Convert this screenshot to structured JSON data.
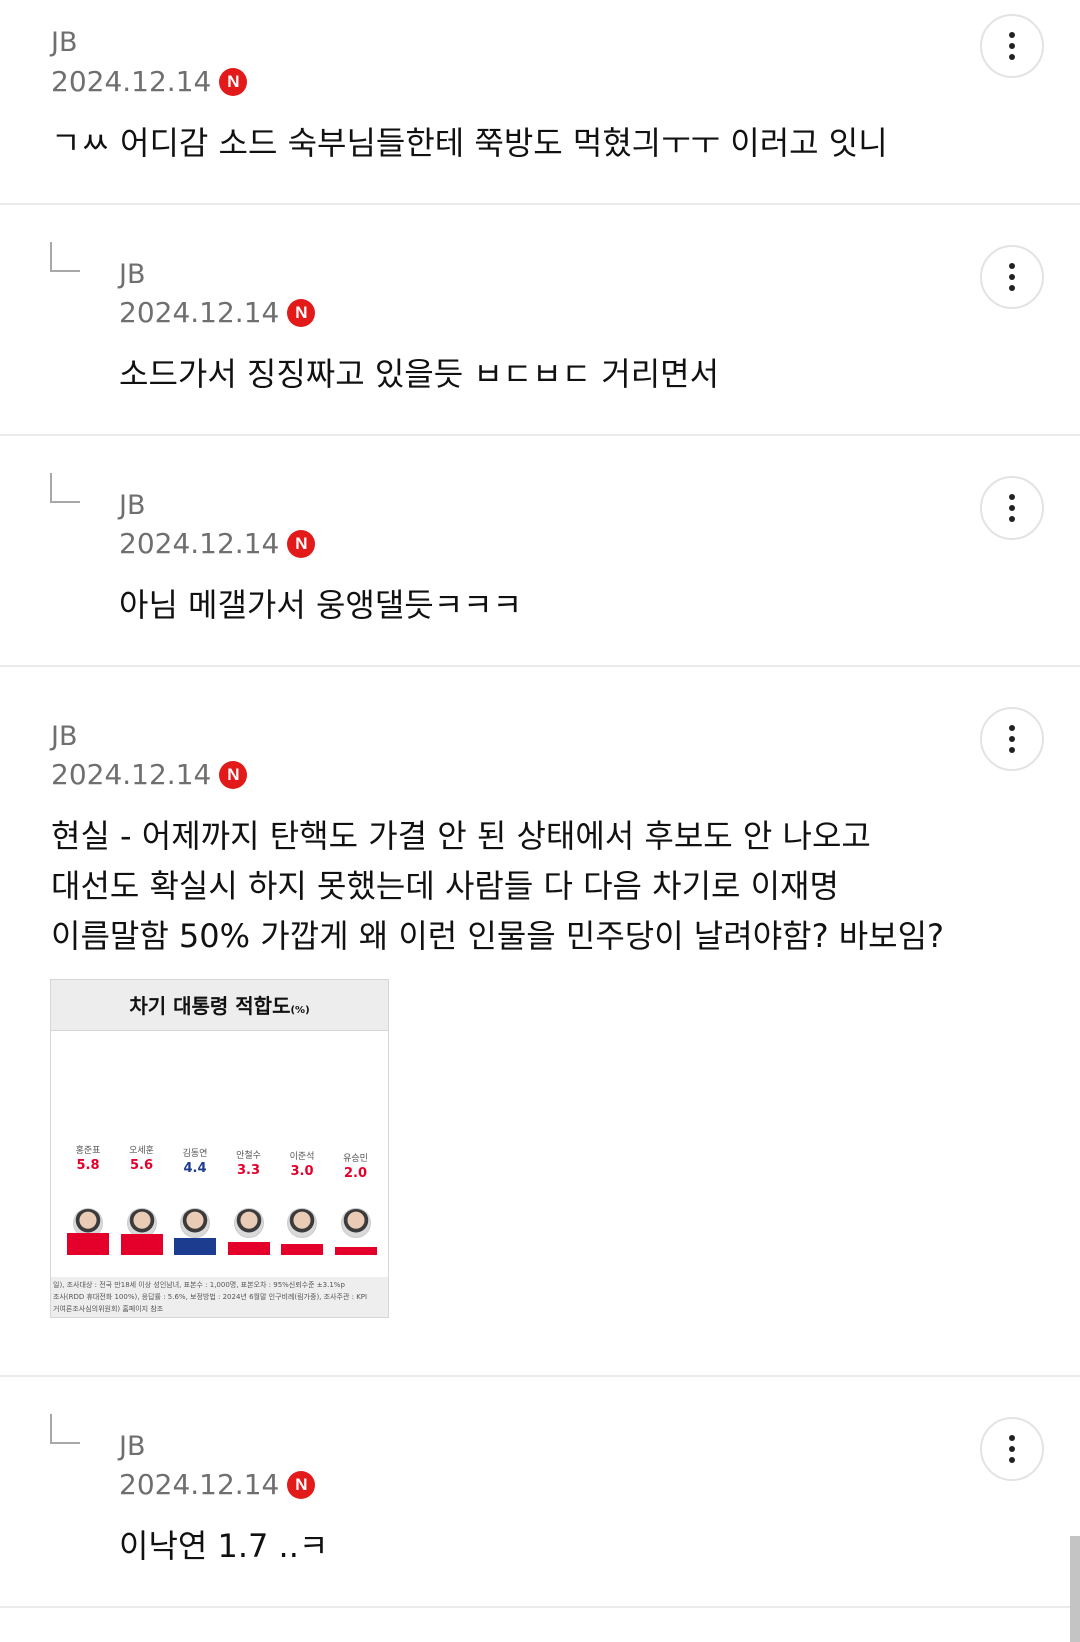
{
  "badge_letter": "N",
  "comments": [
    {
      "author": "JB",
      "date": "2024.12.14",
      "text": "ㄱㅆ 어디감 소드 숙부님들한테 쭉방도 먹혔긔ㅜㅜ 이러고 잇니"
    },
    {
      "author": "JB",
      "date": "2024.12.14",
      "text": "소드가서 징징짜고 있을듯 ㅂㄷㅂㄷ 거리면서"
    },
    {
      "author": "JB",
      "date": "2024.12.14",
      "text": "아님 메갤가서 웅앵댈듯ㅋㅋㅋ"
    },
    {
      "author": "JB",
      "date": "2024.12.14",
      "text": "현실 - 어제까지 탄핵도 가결 안 된 상태에서 후보도 안 나오고\n대선도 확실시 하지 못했는데 사람들 다 다음 차기로 이재명\n이름말함 50% 가깝게 왜 이런 인물을 민주당이 날려야함? 바보임?"
    },
    {
      "author": "JB",
      "date": "2024.12.14",
      "text": "이낙연 1.7 ..ㅋ"
    }
  ],
  "attachment": {
    "title": "차기 대통령 적합도",
    "unit": "(%)",
    "candidates": [
      {
        "name": "홍준표",
        "value": "5.8",
        "color": "#e4002b"
      },
      {
        "name": "오세훈",
        "value": "5.6",
        "color": "#e4002b"
      },
      {
        "name": "김동연",
        "value": "4.4",
        "color": "#1c3d8f"
      },
      {
        "name": "안철수",
        "value": "3.3",
        "color": "#e4002b"
      },
      {
        "name": "이준석",
        "value": "3.0",
        "color": "#e4002b"
      },
      {
        "name": "유승민",
        "value": "2.0",
        "color": "#e4002b"
      }
    ],
    "footnote": [
      "일), 조사대상 : 전국 만18세 이상 성인남녀, 표본수 : 1,000명, 표본오차 : 95%신뢰수준 ±3.1%p",
      "조사(RDD 휴대전화 100%), 응답률 : 5.6%, 보정방법 : 2024년 6월말 인구비례(림가중), 조사주관 : KPI",
      "거여론조사심의위원회) 홈페이지 참조"
    ]
  }
}
